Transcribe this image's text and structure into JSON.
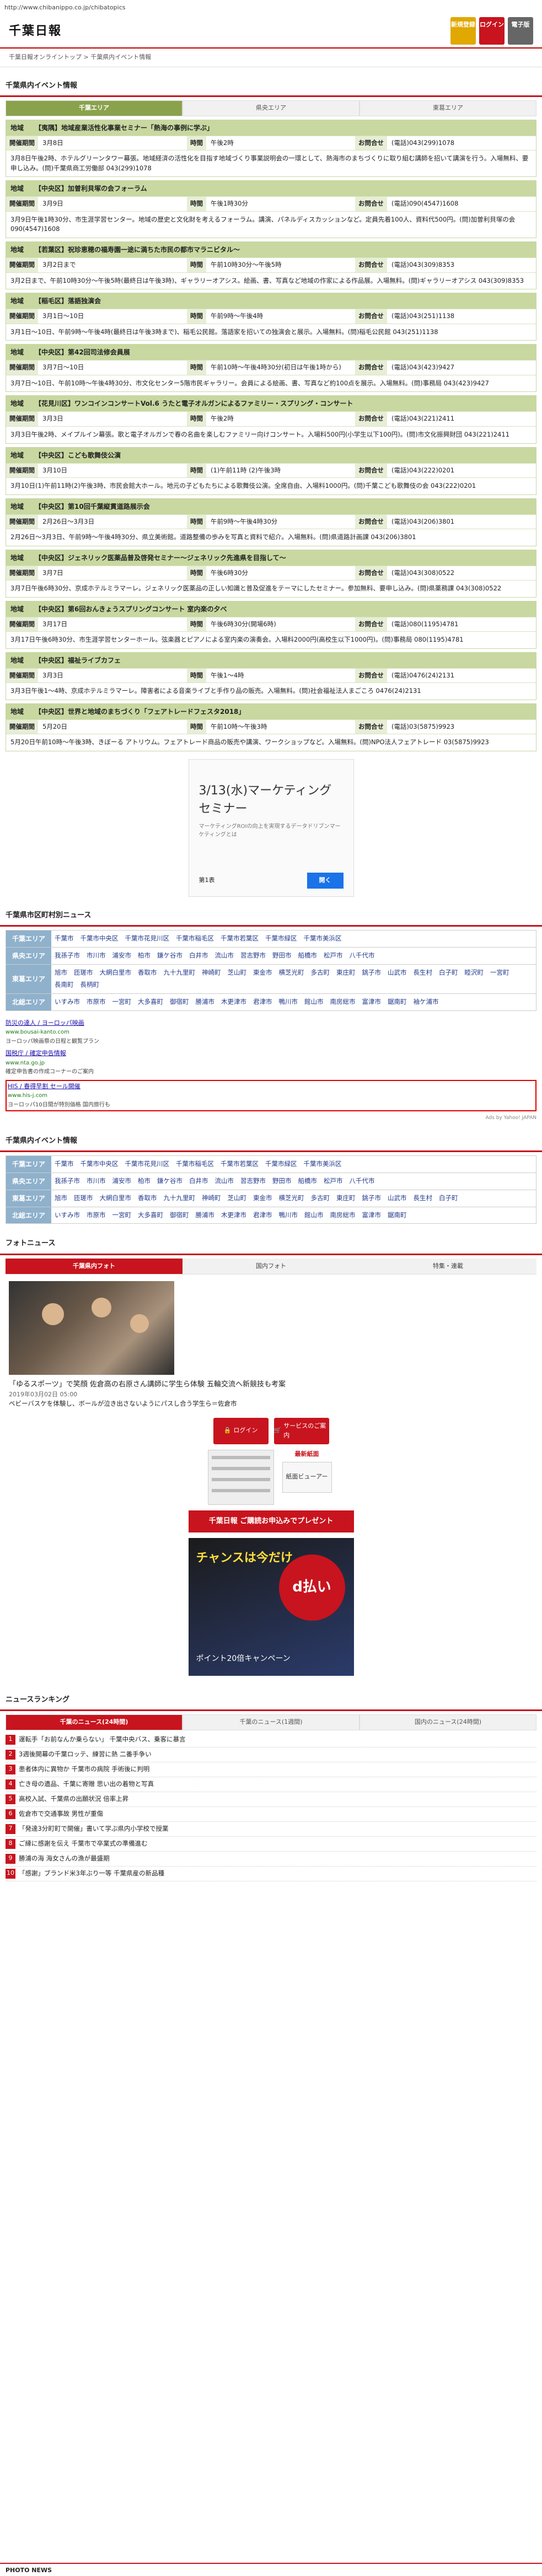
{
  "url": "http://www.chibanippo.co.jp/chibatopics",
  "header": {
    "logo": "千葉日報",
    "buttons": [
      {
        "label": "新規登録",
        "color": "#e0a800"
      },
      {
        "label": "ログイン",
        "color": "#c8141e"
      },
      {
        "label": "電子版",
        "color": "#666666"
      }
    ]
  },
  "breadcrumb": "千葉日報オンライントップ > 千葉県内イベント情報",
  "events_section": {
    "title": "千葉県内イベント情報",
    "tabs": [
      "千葉エリア",
      "県央エリア",
      "東葛エリア"
    ],
    "events": [
      {
        "area": "地域",
        "title": "【夷隅】地域産業活性化事業セミナー「熱海の事例に学ぶ」",
        "date_label": "開催期間",
        "date": "3月8日",
        "time_label": "時間",
        "time": "午後2時",
        "contact_label": "お問合せ",
        "contact": "(電話)043(299)1078",
        "body": "3月8日午後2時、ホテルグリーンタワー幕張。地域経済の活性化を目指す地域づくり事業説明会の一環として、熱海市のまちづくりに取り組む講師を招いて講演を行う。入場無料、要申し込み。(問)千葉県商工労働部 043(299)1078"
      },
      {
        "area": "地域",
        "title": "【中央区】加曽利貝塚の会フォーラム",
        "date_label": "開催期間",
        "date": "3月9日",
        "time_label": "時間",
        "time": "午後1時30分",
        "contact_label": "お問合せ",
        "contact": "(電話)090(4547)1608",
        "body": "3月9日午後1時30分、市生涯学習センター。地域の歴史と文化財を考えるフォーラム。講演、パネルディスカッションなど。定員先着100人、資料代500円。(問)加曽利貝塚の会 090(4547)1608"
      },
      {
        "area": "地域",
        "title": "【若葉区】祝珍恵穂の福寿園一途に満ちた市民の都市マラニビタル〜",
        "date_label": "開催期間",
        "date": "3月2日まで",
        "time_label": "時間",
        "time": "午前10時30分〜午後5時",
        "contact_label": "お問合せ",
        "contact": "(電話)043(309)8353",
        "body": "3月2日まで、午前10時30分〜午後5時(最終日は午後3時)、ギャラリーオアシス。絵画、書、写真など地域の作家による作品展。入場無料。(問)ギャラリーオアシス 043(309)8353"
      },
      {
        "area": "地域",
        "title": "【稲毛区】落語独演会",
        "date_label": "開催期間",
        "date": "3月1日〜10日",
        "time_label": "時間",
        "time": "午前9時〜午後4時",
        "contact_label": "お問合せ",
        "contact": "(電話)043(251)1138",
        "body": "3月1日〜10日、午前9時〜午後4時(最終日は午後3時まで)、稲毛公民館。落語家を招いての独演会と展示。入場無料。(問)稲毛公民館 043(251)1138"
      },
      {
        "area": "地域",
        "title": "【中央区】第42回司法修会員展",
        "date_label": "開催期間",
        "date": "3月7日〜10日",
        "time_label": "時間",
        "time": "午前10時〜午後4時30分(初日は午後1時から)",
        "contact_label": "お問合せ",
        "contact": "(電話)043(423)9427",
        "body": "3月7日〜10日、午前10時〜午後4時30分、市文化センター5階市民ギャラリー。会員による絵画、書、写真など約100点を展示。入場無料。(問)事務局 043(423)9427"
      },
      {
        "area": "地域",
        "title": "【花見川区】ワンコインコンサートVol.6 うたと電子オルガンによるファミリー・スプリング・コンサート",
        "date_label": "開催期間",
        "date": "3月3日",
        "time_label": "時間",
        "time": "午後2時",
        "contact_label": "お問合せ",
        "contact": "(電話)043(221)2411",
        "body": "3月3日午後2時、メイプルイン幕張。歌と電子オルガンで春の名曲を楽しむファミリー向けコンサート。入場料500円(小学生以下100円)。(問)市文化振興財団 043(221)2411"
      },
      {
        "area": "地域",
        "title": "【中央区】こども歌舞伎公演",
        "date_label": "開催期間",
        "date": "3月10日",
        "time_label": "時間",
        "time": "(1)午前11時 (2)午後3時",
        "contact_label": "お問合せ",
        "contact": "(電話)043(222)0201",
        "body": "3月10日(1)午前11時(2)午後3時、市民会館大ホール。地元の子どもたちによる歌舞伎公演。全席自由、入場料1000円。(問)千葉こども歌舞伎の会 043(222)0201"
      },
      {
        "area": "地域",
        "title": "【中央区】第10回千葉縦貫道路展示会",
        "date_label": "開催期間",
        "date": "2月26日〜3月3日",
        "time_label": "時間",
        "time": "午前9時〜午後4時30分",
        "contact_label": "お問合せ",
        "contact": "(電話)043(206)3801",
        "body": "2月26日〜3月3日、午前9時〜午後4時30分、県立美術館。道路整備の歩みを写真と資料で紹介。入場無料。(問)県道路計画課 043(206)3801"
      },
      {
        "area": "地域",
        "title": "【中央区】ジェネリック医薬品普及啓発セミナー〜ジェネリック先進県を目指して〜",
        "date_label": "開催期間",
        "date": "3月7日",
        "time_label": "時間",
        "time": "午後6時30分",
        "contact_label": "お問合せ",
        "contact": "(電話)043(308)0522",
        "body": "3月7日午後6時30分、京成ホテルミラマーレ。ジェネリック医薬品の正しい知識と普及促進をテーマにしたセミナー。参加無料、要申し込み。(問)県薬務課 043(308)0522"
      },
      {
        "area": "地域",
        "title": "【中央区】第6回おんきょうスプリングコンサート 室内楽の夕べ",
        "date_label": "開催期間",
        "date": "3月17日",
        "time_label": "時間",
        "time": "午後6時30分(開場6時)",
        "contact_label": "お問合せ",
        "contact": "(電話)080(1195)4781",
        "body": "3月17日午後6時30分、市生涯学習センターホール。弦楽器とピアノによる室内楽の演奏会。入場料2000円(高校生以下1000円)。(問)事務局 080(1195)4781"
      },
      {
        "area": "地域",
        "title": "【中央区】福祉ライブカフェ",
        "date_label": "開催期間",
        "date": "3月3日",
        "time_label": "時間",
        "time": "午後1〜4時",
        "contact_label": "お問合せ",
        "contact": "(電話)0476(24)2131",
        "body": "3月3日午後1〜4時、京成ホテルミラマーレ。障害者による音楽ライブと手作り品の販売。入場無料。(問)社会福祉法人まごころ 0476(24)2131"
      },
      {
        "area": "地域",
        "title": "【中央区】世界と地域のまちづくり「フェアトレードフェスタ2018」",
        "date_label": "開催期間",
        "date": "5月20日",
        "time_label": "時間",
        "time": "午前10時〜午後3時",
        "contact_label": "お問合せ",
        "contact": "(電話)03(5875)9923",
        "body": "5月20日午前10時〜午後3時、きぼーる アトリウム。フェアトレード商品の販売や講演、ワークショップなど。入場無料。(問)NPO法人フェアトレード 03(5875)9923"
      }
    ]
  },
  "ad": {
    "title": "3/13(水)マーケティングセミナー",
    "text": "マーケティングROIの向上を実現するデータドリブンマーケティングとは",
    "brand": "第1表",
    "button": "開く"
  },
  "news_regions": {
    "title": "千葉県市区町村別ニュース",
    "rows": [
      {
        "label": "千葉エリア",
        "items": [
          "千葉市",
          "千葉市中央区",
          "千葉市花見川区",
          "千葉市稲毛区",
          "千葉市若葉区",
          "千葉市緑区",
          "千葉市美浜区"
        ]
      },
      {
        "label": "県央エリア",
        "items": [
          "我孫子市",
          "市川市",
          "浦安市",
          "柏市",
          "鎌ケ谷市",
          "白井市",
          "流山市",
          "習志野市",
          "野田市",
          "船橋市",
          "松戸市",
          "八千代市"
        ]
      },
      {
        "label": "東葛エリア",
        "items": [
          "旭市",
          "匝瑳市",
          "大網白里市",
          "香取市",
          "九十九里町",
          "神崎町",
          "芝山町",
          "東金市",
          "横芝光町",
          "多古町",
          "東庄町",
          "銚子市",
          "山武市",
          "長生村",
          "白子町",
          "睦沢町",
          "一宮町",
          "長南町",
          "長柄町"
        ]
      },
      {
        "label": "北総エリア",
        "items": [
          "いすみ市",
          "市原市",
          "一宮町",
          "大多喜町",
          "御宿町",
          "勝浦市",
          "木更津市",
          "君津市",
          "鴨川市",
          "館山市",
          "南房総市",
          "富津市",
          "鋸南町",
          "袖ケ浦市"
        ]
      }
    ]
  },
  "ad_links": [
    {
      "title": "防災の達人 / ヨーロッパ映画",
      "url": "www.bousai-kanto.com",
      "desc": "ヨーロッパ映画祭の日程と観覧プラン"
    },
    {
      "title": "国税庁 / 確定申告情報",
      "url": "www.nta.go.jp",
      "desc": "確定申告書の作成コーナーのご案内"
    },
    {
      "title": "HIS / 春得早割 セール開催",
      "url": "www.his-j.com",
      "desc": "ヨーロッパ10日間が特別価格 国内旅行も"
    }
  ],
  "ads_mark": "Ads by Yahoo! JAPAN",
  "events_regions": {
    "title": "千葉県内イベント情報",
    "rows": [
      {
        "label": "千葉エリア",
        "items": [
          "千葉市",
          "千葉市中央区",
          "千葉市花見川区",
          "千葉市稲毛区",
          "千葉市若葉区",
          "千葉市緑区",
          "千葉市美浜区"
        ]
      },
      {
        "label": "県央エリア",
        "items": [
          "我孫子市",
          "市川市",
          "浦安市",
          "柏市",
          "鎌ケ谷市",
          "白井市",
          "流山市",
          "習志野市",
          "野田市",
          "船橋市",
          "松戸市",
          "八千代市"
        ]
      },
      {
        "label": "東葛エリア",
        "items": [
          "旭市",
          "匝瑳市",
          "大網白里市",
          "香取市",
          "九十九里町",
          "神崎町",
          "芝山町",
          "東金市",
          "横芝光町",
          "多古町",
          "東庄町",
          "銚子市",
          "山武市",
          "長生村",
          "白子町"
        ]
      },
      {
        "label": "北総エリア",
        "items": [
          "いすみ市",
          "市原市",
          "一宮町",
          "大多喜町",
          "御宿町",
          "勝浦市",
          "木更津市",
          "君津市",
          "鴨川市",
          "館山市",
          "南房総市",
          "富津市",
          "鋸南町"
        ]
      }
    ]
  },
  "photo_news": {
    "title": "フォトニュース",
    "tabs": [
      "千葉県内フォト",
      "国内フォト",
      "特集・連載"
    ],
    "caption": "「ゆるスポーツ」で笑顔 佐倉高の右原さん講師に学生ら体験 五輪交流へ新競技も考案",
    "date": "2019年03月02日 05:00",
    "desc": "ベビーバスケを体験し、ボールが泣き出さないようにパスし合う学生ら＝佐倉市"
  },
  "side": {
    "login": "ログイン",
    "service": "サービスのご案内",
    "latest": "最新紙面",
    "viewer": "紙面ビューアー",
    "present_banner": "千葉日報 ご購読お申込みでプレゼント",
    "campaign_a": "チャンスは今だけ",
    "campaign_b": "d払い",
    "campaign_c": "ポイント20倍キャンペーン"
  },
  "ranking": {
    "title": "ニュースランキング",
    "tabs": [
      "千葉のニュース(24時間)",
      "千葉のニュース(1週間)",
      "国内のニュース(24時間)"
    ],
    "items": [
      "運転手「お前なんか乗らない」 千葉中央バス、乗客に暴言",
      "3週後開幕の千葉ロッテ、練習に熱 二番手争い",
      "患者体内に異物か 千葉市の病院 手術後に判明",
      "亡き母の遺品、千葉に寄贈 思い出の着物と写真",
      "高校入試、千葉県の出願状況 倍率上昇",
      "佐倉市で交通事故 男性が重傷",
      "「発達3分町町で開催」書いて学ぶ県内小学校で授業",
      "ご縁に感謝を伝え 千葉市で卒業式の準備進む",
      "勝浦の海 海女さんの漁が最盛期",
      "「感謝」ブランド米3年ぶり一等 千葉県産の新品種"
    ]
  },
  "footer": "PHOTO NEWS"
}
